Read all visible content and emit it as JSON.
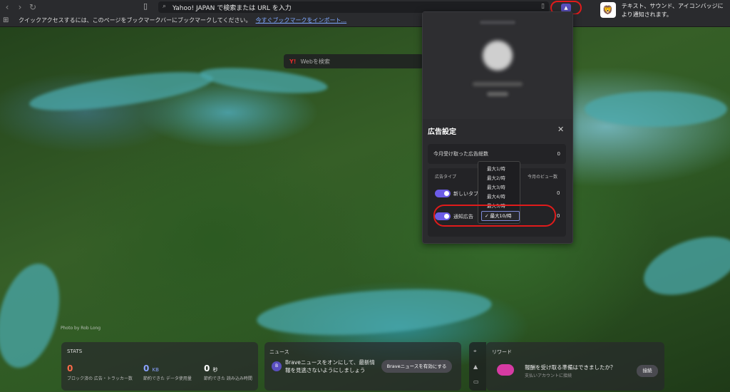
{
  "browser": {
    "url_placeholder": "Yahoo! JAPAN で検索または URL を入力",
    "bookmarks_bar_text": "クイックアクセスするには、このページをブックマークバーにブックマークしてください。",
    "bookmarks_import_link": "今すぐブックマークをインポート..."
  },
  "notification": {
    "text": "テキスト、サウンド、アイコンバッジにより通知されます。"
  },
  "search": {
    "engine_glyph": "Y!",
    "placeholder": "Webを検索"
  },
  "panel": {
    "title": "広告設定",
    "close_glyph": "✕",
    "monthly_label": "今月受け取った広告総数",
    "monthly_value": "0",
    "ad_type_header": "広告タイプ",
    "views_header": "今月のビュー数",
    "ad_types": [
      {
        "label": "新しいタブ",
        "count": "0",
        "enabled": true
      },
      {
        "label": "通知広告",
        "count": "0",
        "enabled": true
      }
    ],
    "frequency_options": [
      "最大1/時",
      "最大2/時",
      "最大3/時",
      "最大4/時",
      "最大5/時"
    ],
    "frequency_selected": "✓ 最大10/時"
  },
  "background": {
    "photo_credit": "Photo by Rob Long"
  },
  "stats": {
    "title": "STATS",
    "items": [
      {
        "value": "0",
        "unit": "",
        "label": "ブロック済の 広告・トラッカー数",
        "color": "#ff6b4a"
      },
      {
        "value": "0",
        "unit": "KB",
        "label": "節約できた データ使用量",
        "color": "#8aa2ff"
      },
      {
        "value": "0",
        "unit": "秒",
        "label": "節約できた 読み込み時間",
        "color": "#ffffff"
      }
    ]
  },
  "news": {
    "title": "ニュース",
    "badge": "B",
    "text": "Braveニュースをオンにして、最新情報を見逃さないようにしましょう",
    "button": "Braveニュースを有効にする"
  },
  "rewards": {
    "title": "リワード",
    "text": "報酬を受け取る準備はできましたか？",
    "sub": "支払いアカウントに接続",
    "button": "接続"
  },
  "colors": {
    "accent": "#6c5ce7",
    "annotation_red": "#e01b1b"
  }
}
